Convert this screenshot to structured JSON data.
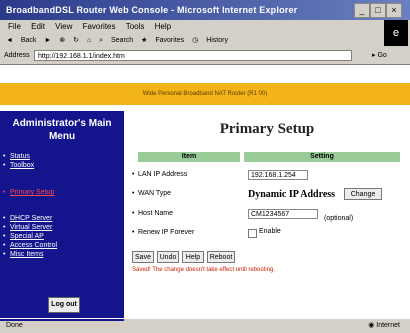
{
  "window": {
    "title": "BroadbandDSL Router Web Console - Microsoft Internet Explorer"
  },
  "menu": [
    "File",
    "Edit",
    "View",
    "Favorites",
    "Tools",
    "Help"
  ],
  "toolbar": {
    "back": "Back",
    "search": "Search",
    "favorites": "Favorites",
    "history": "History"
  },
  "address": {
    "label": "Address",
    "value": "http://192.168.1.1/index.htm",
    "go": "Go"
  },
  "banner": "Wide Personal Broadband NAT Router (R1 00)",
  "sidebar": {
    "title": "Administrator's Main Menu",
    "items": [
      "Status",
      "Toolbox",
      "Primary Setup",
      "DHCP Server",
      "Virtual Server",
      "Special AP",
      "Access Control",
      "Misc Items"
    ],
    "logout": "Log out"
  },
  "main": {
    "title": "Primary Setup",
    "col_item": "Item",
    "col_setting": "Setting",
    "rows": {
      "lan_ip_label": "LAN IP Address",
      "lan_ip_value": "192.168.1.254",
      "wan_type_label": "WAN Type",
      "wan_type_value": "Dynamic IP Address",
      "change_btn": "Change",
      "host_label": "Host Name",
      "host_value": "CM1234567",
      "optional": "(optional)",
      "renew_label": "Renew IP Forever",
      "renew_check": "Enable"
    },
    "buttons": {
      "save": "Save",
      "undo": "Undo",
      "help": "Help",
      "reboot": "Reboot"
    },
    "note": "Saved! The change doesn't take effect until rebooting."
  },
  "status": {
    "left": "Done",
    "right": "Internet"
  }
}
